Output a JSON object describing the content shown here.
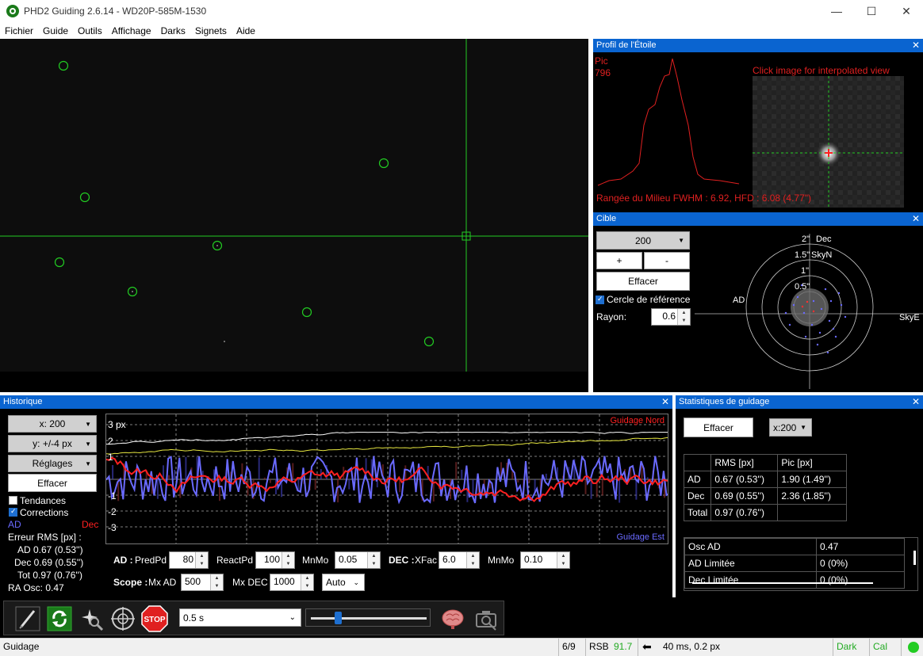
{
  "window": {
    "title": "PHD2 Guiding 2.6.14 - WD20P-585M-1530",
    "minimize": "—",
    "maximize": "☐",
    "close": "✕"
  },
  "menu": [
    "Fichier",
    "Guide",
    "Outils",
    "Affichage",
    "Darks",
    "Signets",
    "Aide"
  ],
  "profile": {
    "title": "Profil de l'Étoile",
    "peak_label": "Pic",
    "peak_value": "796",
    "hint": "Click image for interpolated view",
    "fwhm_text": "Rangée du Milieu FWHM : 6.92, HFD : 6.08 (4.77\")"
  },
  "target": {
    "title": "Cible",
    "scale_select": "200",
    "plus": "+",
    "minus": "-",
    "clear": "Effacer",
    "ref_circle_label": "Cercle de référence",
    "radius_label": "Rayon:",
    "radius_value": "0.6",
    "ring_labels": [
      "2\"",
      "1.5\"",
      "1\"",
      "0.5\""
    ],
    "dec_label": "Dec",
    "skyn_label": "SkyN",
    "ad_label": "AD",
    "skye_label": "SkyE"
  },
  "history": {
    "title": "Historique",
    "x_select": "x: 200",
    "y_select": "y: +/-4 px",
    "settings": "Réglages",
    "clear": "Effacer",
    "trends_label": "Tendances",
    "corrections_label": "Corrections",
    "ad_legend": "AD",
    "dec_legend": "Dec",
    "rms_title": "Erreur RMS [px] :",
    "rms_ad": "AD  0.67 (0.53'')",
    "rms_dec": "Dec  0.69 (0.55'')",
    "rms_tot": "Tot  0.97 (0.76'')",
    "ra_osc": "RA Osc: 0.47",
    "y_ticks": [
      "3 px",
      "2",
      "1",
      "-1",
      "-2",
      "-3"
    ],
    "guide_north": "Guidage Nord",
    "guide_east": "Guidage Est",
    "ad_params_label": "AD :",
    "predpd_label": "PredPd",
    "predpd": "80",
    "reactpd_label": "ReactPd",
    "reactpd": "100",
    "mnmo_ad_label": "MnMo",
    "mnmo_ad": "0.05",
    "dec_params_label": "DEC :",
    "xfac_label": "XFac",
    "xfac": "6.0",
    "mnmo_dec_label": "MnMo",
    "mnmo_dec": "0.10",
    "scope_label": "Scope :",
    "mxad_label": "Mx AD",
    "mxad": "500",
    "mxdec_label": "Mx DEC",
    "mxdec": "1000",
    "dec_mode": "Auto"
  },
  "stats": {
    "title": "Statistiques de guidage",
    "clear": "Effacer",
    "x_select": "x:200",
    "headers": [
      "",
      "RMS [px]",
      "Pic [px]"
    ],
    "rows": [
      [
        "AD",
        "0.67 (0.53'')",
        "1.90 (1.49'')"
      ],
      [
        "Dec",
        "0.69 (0.55'')",
        "2.36 (1.85'')"
      ],
      [
        "Total",
        "0.97 (0.76'')",
        ""
      ]
    ],
    "rows2": [
      [
        "Osc AD",
        "0.47"
      ],
      [
        "AD Limitée",
        "0 (0%)"
      ],
      [
        "Dec Limitée",
        "0 (0%)"
      ]
    ]
  },
  "toolbar": {
    "exposure": "0.5 s",
    "stop_label": "STOP"
  },
  "status": {
    "left": "Guidage",
    "frames": "6/9",
    "snr_label": "RSB",
    "snr_value": "91.7",
    "guide_info": "40 ms, 0.2 px",
    "dark": "Dark",
    "cal": "Cal"
  },
  "colors": {
    "panel_title": "#0a64d0",
    "guide_green": "#22cc22",
    "ra_blue": "#6a6aff",
    "dec_red": "#ff2020",
    "status_green": "#22aa22"
  }
}
